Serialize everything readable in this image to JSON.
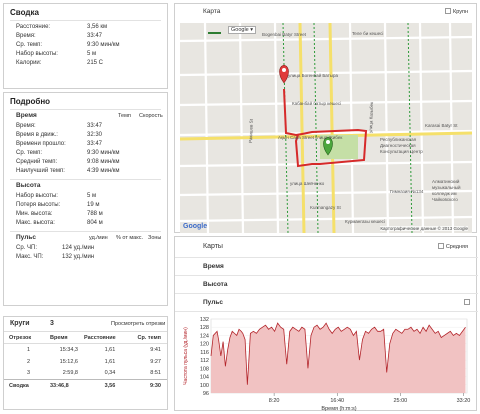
{
  "summary": {
    "title": "Сводка",
    "rows": [
      {
        "label": "Расстояние:",
        "value": "3,56 км"
      },
      {
        "label": "Время:",
        "value": "33:47"
      },
      {
        "label": "Ср. темп:",
        "value": "9:30 мин/км"
      },
      {
        "label": "Набор высоты:",
        "value": "5 м"
      },
      {
        "label": "Калории:",
        "value": "215 C"
      }
    ]
  },
  "details": {
    "title": "Подробно",
    "time": {
      "heading": "Время",
      "col_pace": "Темп",
      "col_speed": "Скорость",
      "rows": [
        {
          "label": "Время:",
          "value": "33:47"
        },
        {
          "label": "Время в движ.:",
          "value": "32:30"
        },
        {
          "label": "Времени прошло:",
          "value": "33:47"
        },
        {
          "label": "Ср. темп:",
          "value": "9:30 мин/км"
        },
        {
          "label": "Средний темп:",
          "value": "9:08 мин/км"
        },
        {
          "label": "Наилучший темп:",
          "value": "4:39 мин/км"
        }
      ]
    },
    "altitude": {
      "heading": "Высота",
      "rows": [
        {
          "label": "Набор высоты:",
          "value": "5 м"
        },
        {
          "label": "Потеря высоты:",
          "value": "19 м"
        },
        {
          "label": "Мин. высота:",
          "value": "788 м"
        },
        {
          "label": "Макс. высота:",
          "value": "804 м"
        }
      ]
    },
    "pulse": {
      "heading": "Пульс",
      "col1": "уд./мин",
      "col2": "% от макс.",
      "col3": "Зоны",
      "rows": [
        {
          "label": "Ср. ЧП:",
          "value": "124 уд./мин"
        },
        {
          "label": "Макс. ЧП:",
          "value": "132 уд./мин"
        }
      ]
    }
  },
  "laps": {
    "title": "Круги",
    "count": "3",
    "view_link": "Просмотреть отрезки",
    "headers": [
      "Отрезок",
      "Время",
      "Расстояние",
      "Ср. темп"
    ],
    "rows": [
      [
        "1",
        "15:34,3",
        "1,61",
        "9:41"
      ],
      [
        "2",
        "15:12,6",
        "1,61",
        "9:27"
      ],
      [
        "3",
        "2:59,8",
        "0,34",
        "8:51"
      ]
    ],
    "summary_row": [
      "Сводка",
      "33:46,8",
      "3,56",
      "9:30"
    ]
  },
  "map": {
    "title": "Карта",
    "checkbox_label": "Крупн",
    "type_select": "Google",
    "attribution": "Картографические данные © 2013 Google",
    "google_logo": "Google",
    "streets": [
      "Bogenbai Batyr Street",
      "улица Богенбай Батыра",
      "Кабанбай батыр кешесі",
      "улица Жибек",
      "улица Шевченко",
      "Kurmangazy St",
      "Курмангазы кешесі",
      "Ракишев St",
      "Teлe би кешесі",
      "Ақын Сара Street",
      "улица Казыбек",
      "Гимназия №134",
      "Республиканская Диагностическая Консультация Центр",
      "Алматинский музыкальный колледж им Чайковского",
      "Karasai Batyr St"
    ]
  },
  "charts": {
    "title": "Карты",
    "checkbox_label": "Средняя",
    "sections": [
      "Время",
      "Высота",
      "Пульс"
    ],
    "xlabel": "Время (h:m:s)",
    "ylabel": "Частота пульса (уд./мин)"
  },
  "chart_data": {
    "type": "area",
    "title": "",
    "xlabel": "Время (h:m:s)",
    "ylabel": "Частота пульса (уд./мин)",
    "ylim": [
      96,
      132
    ],
    "yticks": [
      96,
      100,
      104,
      108,
      112,
      116,
      120,
      124,
      128,
      132
    ],
    "xlim": [
      0,
      33.8
    ],
    "xtick_labels": [
      "8:20",
      "16:40",
      "25:00",
      "33:20"
    ],
    "xtick_values": [
      8.333,
      16.667,
      25.0,
      33.333
    ],
    "color": "#b3242a",
    "fill": "#f1c2c2",
    "series": [
      {
        "x": [
          0,
          0.3,
          0.8,
          1.0,
          1.3,
          1.6,
          1.9,
          2.2,
          2.5,
          2.8,
          3.1,
          3.4,
          3.7,
          4.0,
          4.2,
          4.5,
          4.8,
          5.0,
          5.2,
          5.6,
          6.0,
          6.4,
          6.8,
          7.2,
          7.6,
          8.0,
          8.4,
          8.8,
          9.2,
          9.6,
          10.0,
          10.4,
          10.8,
          11.2,
          11.6,
          12.0,
          12.4,
          12.8,
          13.2,
          13.6,
          14.0,
          14.4,
          14.8,
          15.2,
          15.6,
          16.0,
          16.4,
          16.8,
          17.2,
          17.6,
          18.0,
          18.4,
          18.8,
          19.2,
          19.6,
          20.0,
          20.4,
          20.8,
          21.2,
          21.6,
          22.0,
          22.4,
          22.8,
          23.2,
          23.6,
          24.0,
          24.4,
          24.8,
          25.2,
          25.6,
          26.0,
          26.4,
          26.8,
          27.2,
          27.6,
          28.0,
          28.4,
          28.8,
          29.2,
          29.6,
          30.0,
          30.4,
          30.8,
          31.2,
          31.6,
          32.0,
          32.4,
          32.8,
          33.2,
          33.6
        ],
        "y": [
          114,
          124,
          126,
          122,
          114,
          121,
          109,
          117,
          123,
          126,
          125,
          124,
          127,
          126,
          125,
          122,
          100,
          112,
          125,
          126,
          125,
          127,
          128,
          129,
          127,
          128,
          126,
          130,
          128,
          127,
          110,
          126,
          128,
          127,
          126,
          128,
          127,
          108,
          124,
          128,
          129,
          127,
          128,
          130,
          127,
          125,
          127,
          128,
          126,
          127,
          128,
          127,
          124,
          126,
          112,
          122,
          126,
          125,
          127,
          128,
          126,
          126,
          127,
          106,
          120,
          125,
          127,
          126,
          125,
          127,
          127,
          128,
          126,
          127,
          125,
          128,
          126,
          129,
          127,
          125,
          126,
          123,
          124,
          125,
          126,
          124,
          125,
          124,
          126,
          128
        ]
      }
    ]
  }
}
